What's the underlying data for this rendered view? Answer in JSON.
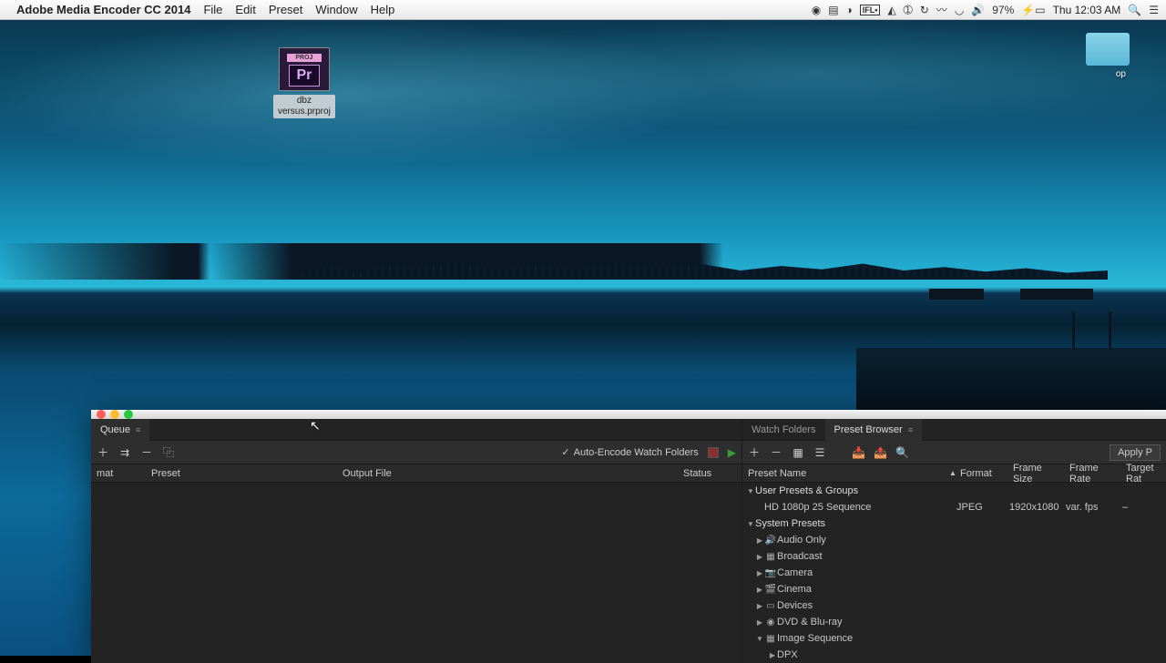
{
  "menubar": {
    "app_name": "Adobe Media Encoder CC 2014",
    "items": [
      "File",
      "Edit",
      "Preset",
      "Window",
      "Help"
    ],
    "battery": "97%",
    "clock": "Thu 12:03 AM"
  },
  "desktop": {
    "folder_label": "op",
    "file_label": "dbz\nversus.prproj",
    "file_badge": "Pr"
  },
  "queue_panel": {
    "tab_label": "Queue",
    "auto_encode_label": "Auto-Encode Watch Folders",
    "columns": {
      "format": "mat",
      "preset": "Preset",
      "output": "Output File",
      "status": "Status"
    }
  },
  "right_panel": {
    "tab_watch": "Watch Folders",
    "tab_preset": "Preset Browser",
    "apply_label": "Apply P",
    "columns": {
      "name": "Preset Name",
      "format": "Format",
      "size": "Frame Size",
      "rate": "Frame Rate",
      "target": "Target Rat"
    },
    "user_group": "User Presets & Groups",
    "user_preset": {
      "name": "HD 1080p 25 Sequence",
      "format": "JPEG",
      "size": "1920x1080",
      "rate": "var. fps",
      "target": "–"
    },
    "system_group": "System Presets",
    "categories": [
      {
        "icon": "🔊",
        "label": "Audio Only"
      },
      {
        "icon": "▦",
        "label": "Broadcast"
      },
      {
        "icon": "📷",
        "label": "Camera"
      },
      {
        "icon": "🎬",
        "label": "Cinema"
      },
      {
        "icon": "▭",
        "label": "Devices"
      },
      {
        "icon": "◉",
        "label": "DVD & Blu-ray"
      }
    ],
    "image_seq": {
      "icon": "▦",
      "label": "Image Sequence"
    },
    "dpx_label": "DPX"
  }
}
